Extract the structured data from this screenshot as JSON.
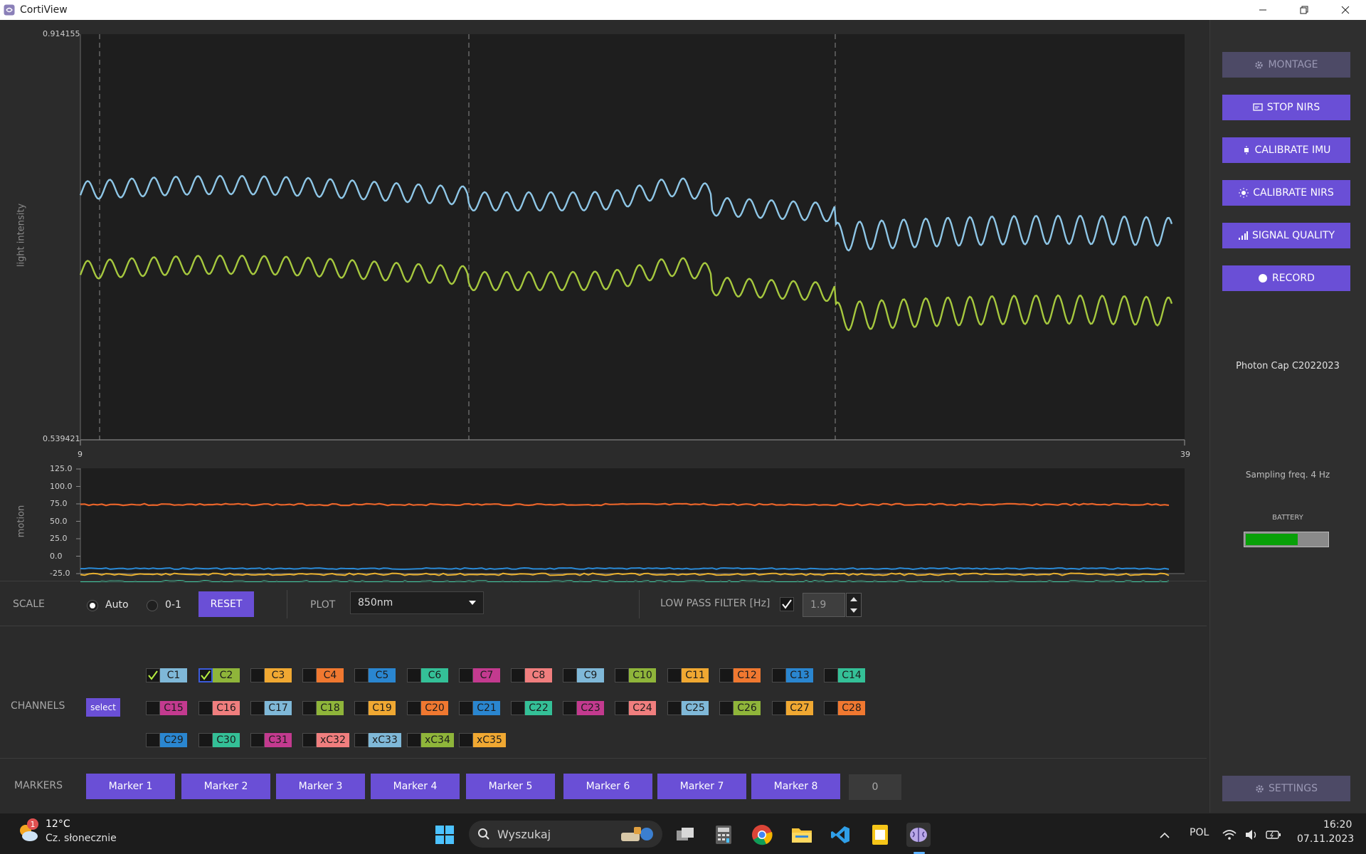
{
  "app": {
    "title": "CortiView"
  },
  "plot_main": {
    "ylabel": "light intensity",
    "ymax_label": "0.914155",
    "ymin_label": "0.539421",
    "x_start_label": "9",
    "x_end_label": "39",
    "background": "#1e1e1e"
  },
  "plot_motion": {
    "ylabel": "motion",
    "ticks": [
      "125.0",
      "100.0",
      "75.0",
      "50.0",
      "25.0",
      "0.0",
      "-25.0"
    ]
  },
  "controls": {
    "scale_label": "SCALE",
    "auto_label": "Auto",
    "zero_one_label": "0-1",
    "scale_selected": "Auto",
    "reset_label": "RESET",
    "plot_label": "PLOT",
    "plot_value": "850nm",
    "lpf_label": "LOW PASS FILTER [Hz]",
    "lpf_enabled": true,
    "lpf_value": "1.9"
  },
  "channels": {
    "label": "CHANNELS",
    "select_label": "select",
    "rows": [
      [
        {
          "name": "C1",
          "color": "#7fb8d8",
          "checked": true
        },
        {
          "name": "C2",
          "color": "#8fb53a",
          "checked": true
        },
        {
          "name": "C3",
          "color": "#f0a832",
          "checked": false
        },
        {
          "name": "C4",
          "color": "#f07830",
          "checked": false
        },
        {
          "name": "C5",
          "color": "#2a86d0",
          "checked": false
        },
        {
          "name": "C6",
          "color": "#34c097",
          "checked": false
        },
        {
          "name": "C7",
          "color": "#c33a8f",
          "checked": false
        },
        {
          "name": "C8",
          "color": "#f07e7e",
          "checked": false
        },
        {
          "name": "C9",
          "color": "#7fb8d8",
          "checked": false
        },
        {
          "name": "C10",
          "color": "#8fb53a",
          "checked": false
        },
        {
          "name": "C11",
          "color": "#f0a832",
          "checked": false
        },
        {
          "name": "C12",
          "color": "#f07830",
          "checked": false
        },
        {
          "name": "C13",
          "color": "#2a86d0",
          "checked": false
        },
        {
          "name": "C14",
          "color": "#34c097",
          "checked": false
        }
      ],
      [
        {
          "name": "C15",
          "color": "#c33a8f",
          "checked": false
        },
        {
          "name": "C16",
          "color": "#f07e7e",
          "checked": false
        },
        {
          "name": "C17",
          "color": "#7fb8d8",
          "checked": false
        },
        {
          "name": "C18",
          "color": "#8fb53a",
          "checked": false
        },
        {
          "name": "C19",
          "color": "#f0a832",
          "checked": false
        },
        {
          "name": "C20",
          "color": "#f07830",
          "checked": false
        },
        {
          "name": "C21",
          "color": "#2a86d0",
          "checked": false
        },
        {
          "name": "C22",
          "color": "#34c097",
          "checked": false
        },
        {
          "name": "C23",
          "color": "#c33a8f",
          "checked": false
        },
        {
          "name": "C24",
          "color": "#f07e7e",
          "checked": false
        },
        {
          "name": "C25",
          "color": "#7fb8d8",
          "checked": false
        },
        {
          "name": "C26",
          "color": "#8fb53a",
          "checked": false
        },
        {
          "name": "C27",
          "color": "#f0a832",
          "checked": false
        },
        {
          "name": "C28",
          "color": "#f07830",
          "checked": false
        }
      ],
      [
        {
          "name": "C29",
          "color": "#2a86d0",
          "checked": false
        },
        {
          "name": "C30",
          "color": "#34c097",
          "checked": false
        },
        {
          "name": "C31",
          "color": "#c33a8f",
          "checked": false
        },
        {
          "name": "xC32",
          "color": "#f07e7e",
          "checked": false
        },
        {
          "name": "xC33",
          "color": "#7fb8d8",
          "checked": false
        },
        {
          "name": "xC34",
          "color": "#8fb53a",
          "checked": false
        },
        {
          "name": "xC35",
          "color": "#f0a832",
          "checked": false
        }
      ]
    ]
  },
  "markers": {
    "label": "MARKERS",
    "buttons": [
      "Marker 1",
      "Marker 2",
      "Marker 3",
      "Marker 4",
      "Marker 5",
      "Marker 6",
      "Marker 7",
      "Marker 8"
    ],
    "count": "0"
  },
  "sidebar": {
    "buttons": [
      {
        "label": "MONTAGE",
        "icon": "gear-icon",
        "disabled": true
      },
      {
        "label": "STOP NIRS",
        "icon": "cast-icon",
        "disabled": false
      },
      {
        "label": "CALIBRATE IMU",
        "icon": "imu-icon",
        "disabled": false
      },
      {
        "label": "CALIBRATE NIRS",
        "icon": "sun-icon",
        "disabled": false
      },
      {
        "label": "SIGNAL QUALITY",
        "icon": "signal-bars-icon",
        "disabled": false
      },
      {
        "label": "RECORD",
        "icon": "record-dot-icon",
        "disabled": false
      }
    ],
    "device": "Photon Cap C2022023",
    "sampling": "Sampling freq. 4 Hz",
    "battery_label": "BATTERY",
    "battery_level": 0.63,
    "settings_label": "SETTINGS"
  },
  "taskbar": {
    "weather_temp": "12°C",
    "weather_desc": "Cz. słonecznie",
    "weather_badge": "1",
    "search_placeholder": "Wyszukaj",
    "lang": "POL",
    "time": "16:20",
    "date": "07.11.2023"
  }
}
